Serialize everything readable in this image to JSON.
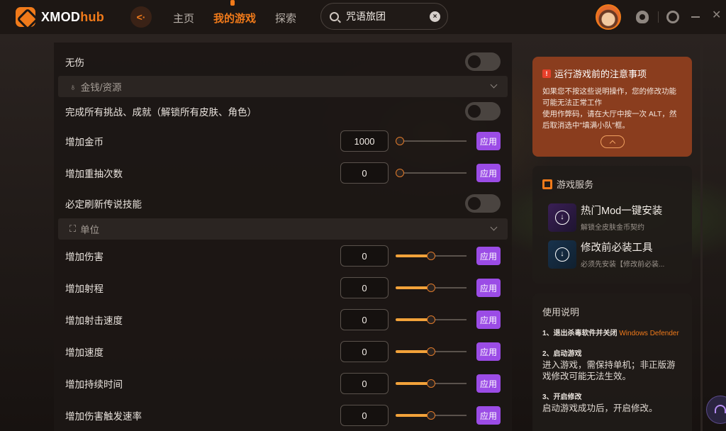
{
  "app": {
    "logo_main": "XMOD",
    "logo_accent": "hub"
  },
  "nav": [
    {
      "label": "主页",
      "active": false
    },
    {
      "label": "我的游戏",
      "active": true
    },
    {
      "label": "探索",
      "active": false
    }
  ],
  "search": {
    "value": "咒语旅团"
  },
  "icons": {
    "close_glyph": "✕",
    "clear_glyph": "×",
    "back_glyph": "<·",
    "download_glyph": "↓",
    "warn_glyph": "!"
  },
  "sections": [
    {
      "label": "金钱/资源",
      "icon": "coin-bag-icon",
      "icon_glyph": "♁"
    },
    {
      "label": "单位",
      "icon": "unit-icon",
      "icon_glyph": "⛶"
    }
  ],
  "rows": [
    {
      "label": "无伤",
      "type": "toggle",
      "on": false
    },
    {
      "label": "完成所有挑战、成就（解锁所有皮肤、角色）",
      "type": "toggle",
      "on": false
    },
    {
      "label": "增加金币",
      "type": "input",
      "value": "1000",
      "slider_fraction": 0.0,
      "apply": "应用"
    },
    {
      "label": "增加重抽次数",
      "type": "input",
      "value": "0",
      "slider_fraction": 0.0,
      "apply": "应用"
    },
    {
      "label": "必定刷新传说技能",
      "type": "toggle",
      "on": false
    },
    {
      "label": "增加伤害",
      "type": "input",
      "value": "0",
      "slider_fraction": 0.5,
      "apply": "应用"
    },
    {
      "label": "增加射程",
      "type": "input",
      "value": "0",
      "slider_fraction": 0.5,
      "apply": "应用"
    },
    {
      "label": "增加射击速度",
      "type": "input",
      "value": "0",
      "slider_fraction": 0.5,
      "apply": "应用"
    },
    {
      "label": "增加速度",
      "type": "input",
      "value": "0",
      "slider_fraction": 0.5,
      "apply": "应用"
    },
    {
      "label": "增加持续时间",
      "type": "input",
      "value": "0",
      "slider_fraction": 0.5,
      "apply": "应用"
    },
    {
      "label": "增加伤害触发速率",
      "type": "input",
      "value": "0",
      "slider_fraction": 0.5,
      "apply": "应用"
    }
  ],
  "notice": {
    "title": "运行游戏前的注意事项",
    "line1": "如果您不按这些说明操作，您的修改功能可能无法正常工作",
    "line2": "使用作弊码，请在大厅中按一次 ALT，然后取消选中\"填满小队\"框。"
  },
  "services": {
    "title": "游戏服务",
    "items": [
      {
        "title": "热门Mod一键安装",
        "sub": "解锁全皮肤金币契约"
      },
      {
        "title": "修改前必装工具",
        "sub": "必须先安装【修改前必装..."
      }
    ]
  },
  "help": {
    "title": "使用说明",
    "step1_head": "1、退出杀毒软件并关闭",
    "step1_highlight": "Windows Defender",
    "step2_head": "2、启动游戏",
    "step2_body": "进入游戏，需保持单机；非正版游戏修改可能无法生效。",
    "step3_head": "3、开启修改",
    "step3_body": "启动游戏成功后，开启修改。"
  },
  "colors": {
    "accent": "#f07a1a",
    "apply": "#9b4ce6",
    "notice_bg": "#8a3d1e",
    "slider_fill": "#f2a23a"
  }
}
